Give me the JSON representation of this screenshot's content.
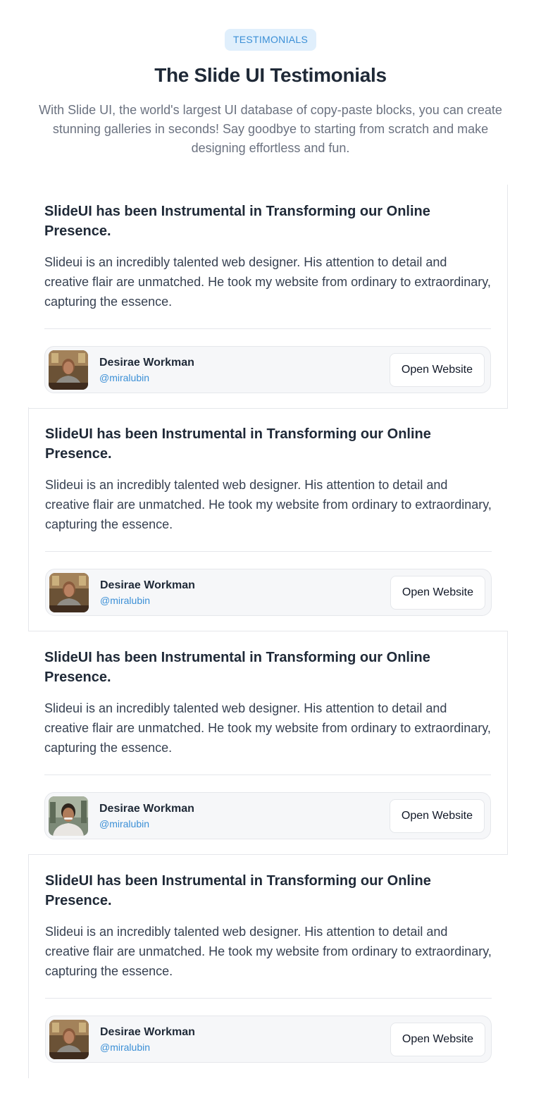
{
  "header": {
    "badge": "TESTIMONIALS",
    "title": "The Slide UI Testimonials",
    "subtitle": "With Slide UI, the world's largest UI database of copy-paste blocks, you can create stunning galleries in seconds! Say goodbye to starting from scratch and make designing effortless and fun."
  },
  "testimonials": [
    {
      "title": "SlideUI has been Instrumental in Transforming our Online Presence.",
      "body": "Slideui is an incredibly talented web designer. His attention to detail and creative flair are unmatched. He took my website from ordinary to extraordinary, capturing the essence.",
      "author": "Desirae Workman",
      "handle": "@miralubin",
      "button": "Open Website",
      "avatar": "woman-portrait"
    },
    {
      "title": "SlideUI has been Instrumental in Transforming our Online Presence.",
      "body": "Slideui is an incredibly talented web designer. His attention to detail and creative flair are unmatched. He took my website from ordinary to extraordinary, capturing the essence.",
      "author": "Desirae Workman",
      "handle": "@miralubin",
      "button": "Open Website",
      "avatar": "woman-portrait"
    },
    {
      "title": "SlideUI has been Instrumental in Transforming our Online Presence.",
      "body": "Slideui is an incredibly talented web designer. His attention to detail and creative flair are unmatched. He took my website from ordinary to extraordinary, capturing the essence.",
      "author": "Desirae Workman",
      "handle": "@miralubin",
      "button": "Open Website",
      "avatar": "man-portrait"
    },
    {
      "title": "SlideUI has been Instrumental in Transforming our Online Presence.",
      "body": "Slideui is an incredibly talented web designer. His attention to detail and creative flair are unmatched. He took my website from ordinary to extraordinary, capturing the essence.",
      "author": "Desirae Workman",
      "handle": "@miralubin",
      "button": "Open Website",
      "avatar": "woman-portrait"
    }
  ],
  "colors": {
    "accent": "#3b8fd6",
    "badge_bg": "#e0effc",
    "border": "#e5e7eb",
    "author_bg": "#f6f7f9"
  }
}
